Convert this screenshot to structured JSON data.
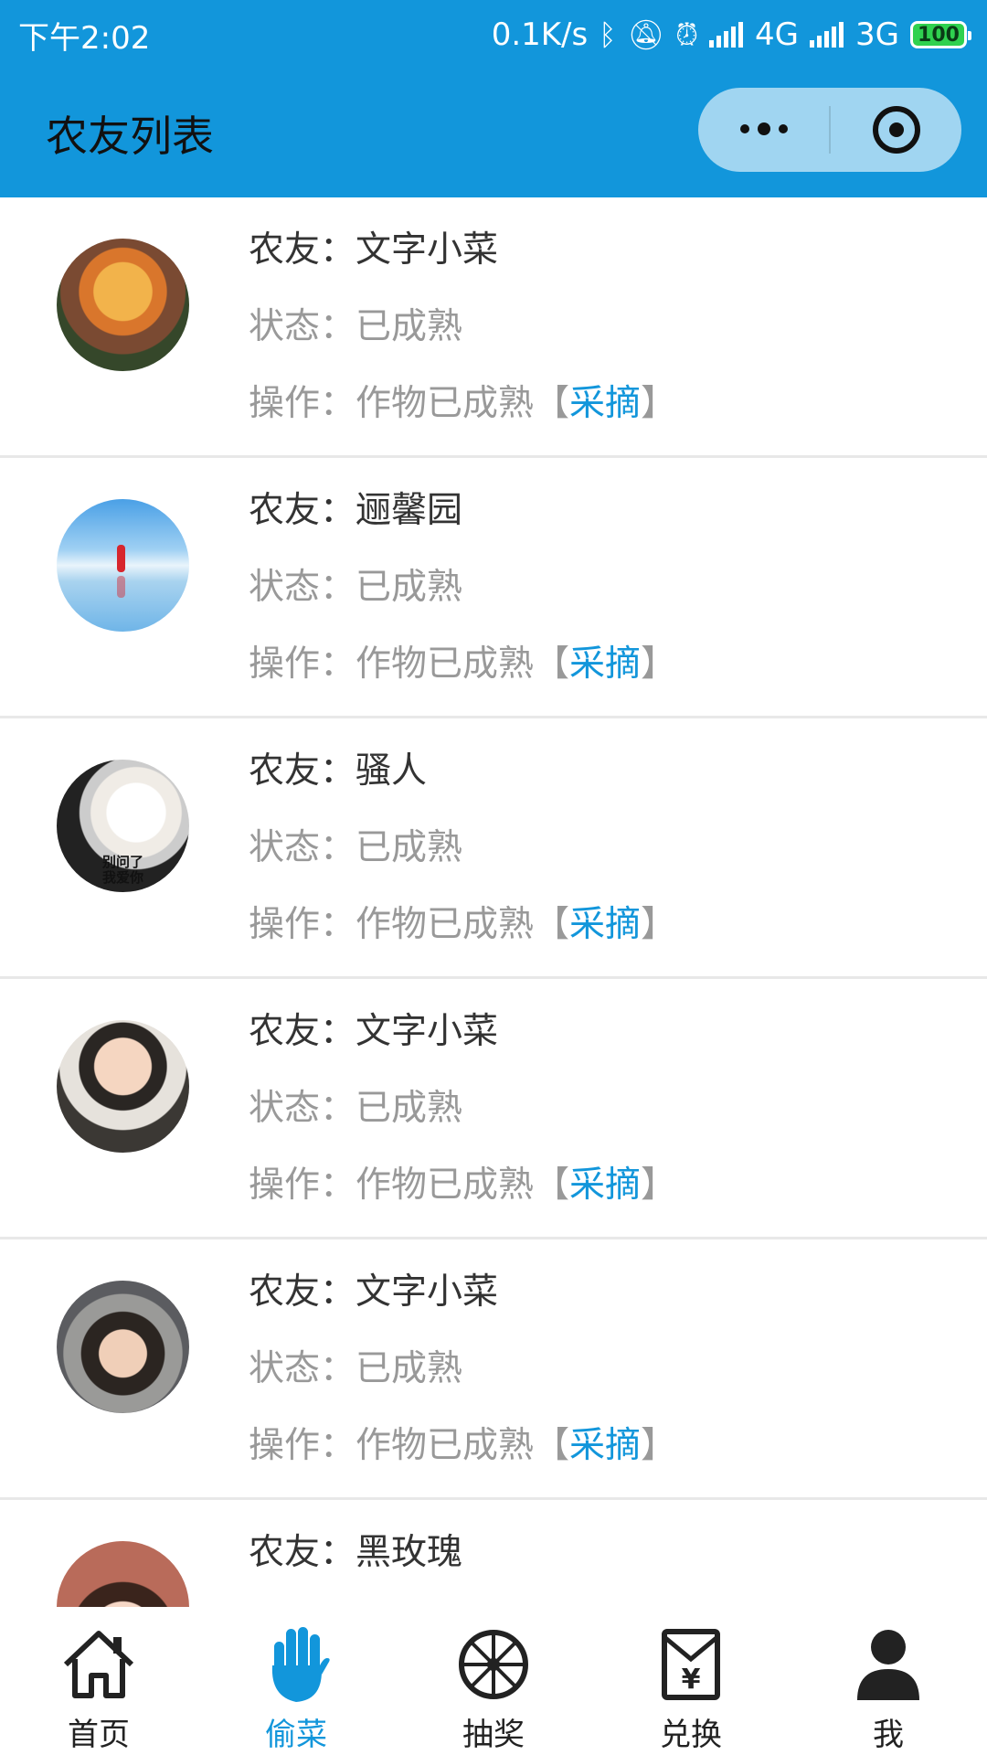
{
  "status_bar": {
    "time": "下午2:02",
    "net_speed": "0.1K/s",
    "network_1": "4G",
    "network_2": "3G",
    "battery": "100"
  },
  "nav": {
    "title": "农友列表",
    "more_icon": "more-dots-icon",
    "close_icon": "target-circle-icon"
  },
  "labels": {
    "friend_prefix": "农友：",
    "status_prefix": "状态：",
    "action_prefix": "操作：",
    "action_text": "作物已成熟",
    "bracket_open": "【",
    "bracket_close": "】",
    "pick": "采摘"
  },
  "friends": [
    {
      "name": "文字小菜",
      "status": "已成熟"
    },
    {
      "name": "逦馨园",
      "status": "已成熟"
    },
    {
      "name": "骚人",
      "status": "已成熟",
      "avatar_caption": "别问了\n我爱你"
    },
    {
      "name": "文字小菜",
      "status": "已成熟"
    },
    {
      "name": "文字小菜",
      "status": "已成熟"
    },
    {
      "name": "黑玫瑰"
    }
  ],
  "tabbar": {
    "items": [
      {
        "label": "首页",
        "icon": "home-icon"
      },
      {
        "label": "偷菜",
        "icon": "hand-icon",
        "active": true
      },
      {
        "label": "抽奖",
        "icon": "wheel-icon"
      },
      {
        "label": "兑换",
        "icon": "voucher-yen-icon"
      },
      {
        "label": "我",
        "icon": "user-icon"
      }
    ]
  },
  "colors": {
    "primary": "#1296db",
    "text_dark": "#333333",
    "text_gray": "#999999",
    "divider": "#e8e8e8"
  }
}
